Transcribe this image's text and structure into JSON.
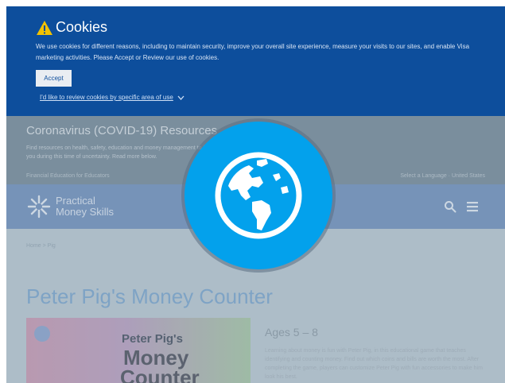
{
  "cookie_banner": {
    "title": "Cookies",
    "text": "We use cookies for different reasons, including to maintain security, improve your overall site experience, measure your visits to our sites, and enable Visa marketing activities. Please Accept or Review our use of cookies.",
    "accept_label": "Accept",
    "review_link": "I'd like to review cookies by specific area of use"
  },
  "covid": {
    "title": "Coronavirus (COVID-19) Resources",
    "text": "Find resources on health, safety, education and money management to help you during this time of uncertainty. Read more below.",
    "topbar_left": "Financial Education for Educators",
    "topbar_right": "Select a Language · United States"
  },
  "header": {
    "logo_line1": "Practical",
    "logo_line2": "Money Skills"
  },
  "main": {
    "breadcrumb": "Home > Pig",
    "page_title": "Peter Pig's Money Counter",
    "thumb_line1": "Peter Pig's",
    "thumb_line2": "Money",
    "thumb_line3": "Counter",
    "ages_heading": "Ages 5 – 8",
    "ages_text": "Learning about money is fun with Peter Pig, in this educational game that teaches identifying and counting money. Find out which coins and bills are worth the most. After completing the game, players can customize Peter Pig with fun accessories to make him look his best."
  },
  "colors": {
    "banner": "#0d4e9c",
    "globe_badge": "#03a1ec",
    "header": "#7695bf"
  },
  "icons": {
    "warning": "warning-icon",
    "globe": "globe-icon",
    "search": "search-icon",
    "menu": "menu-icon"
  }
}
